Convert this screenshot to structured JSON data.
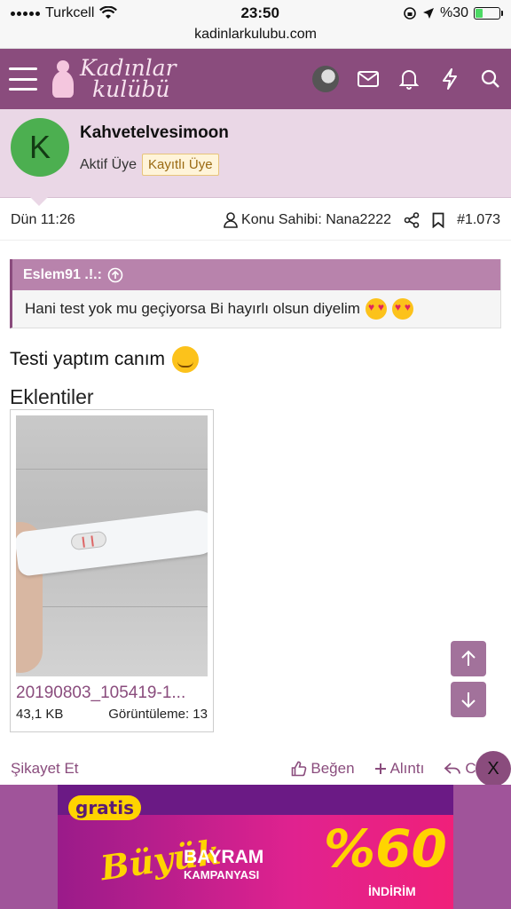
{
  "status_bar": {
    "carrier": "Turkcell",
    "time": "23:50",
    "battery": "%30",
    "battery_level": 0.3
  },
  "browser": {
    "url": "kadinlarkulubu.com"
  },
  "header": {
    "logo_line1": "Kadınlar",
    "logo_line2": "kulübü"
  },
  "post": {
    "avatar_letter": "K",
    "username": "Kahvetelvesimoon",
    "role": "Aktif Üye",
    "badge": "Kayıtlı Üye",
    "time": "Dün 11:26",
    "owner": "Konu Sahibi: Nana2222",
    "number": "#1.073",
    "quote": {
      "author": "Eslem91 .!.:",
      "text": "Hani test yok mu geçiyorsa Bi hayırlı olsun diyelim"
    },
    "text": "Testi yaptım canım",
    "attachments_title": "Eklentiler",
    "attachment": {
      "filename": "20190803_105419-1...",
      "size": "43,1 KB",
      "views": "Görüntüleme: 13"
    }
  },
  "actions": {
    "report": "Şikayet Et",
    "like": "Beğen",
    "quote": "Alıntı",
    "reply": "Ceva"
  },
  "ad": {
    "close": "X",
    "brand": "gratis",
    "script": "Büyük",
    "bayram": "BAYRAM",
    "kampanya": "KAMPANYASI",
    "percent": "%60",
    "indirim": "İNDİRİM"
  }
}
